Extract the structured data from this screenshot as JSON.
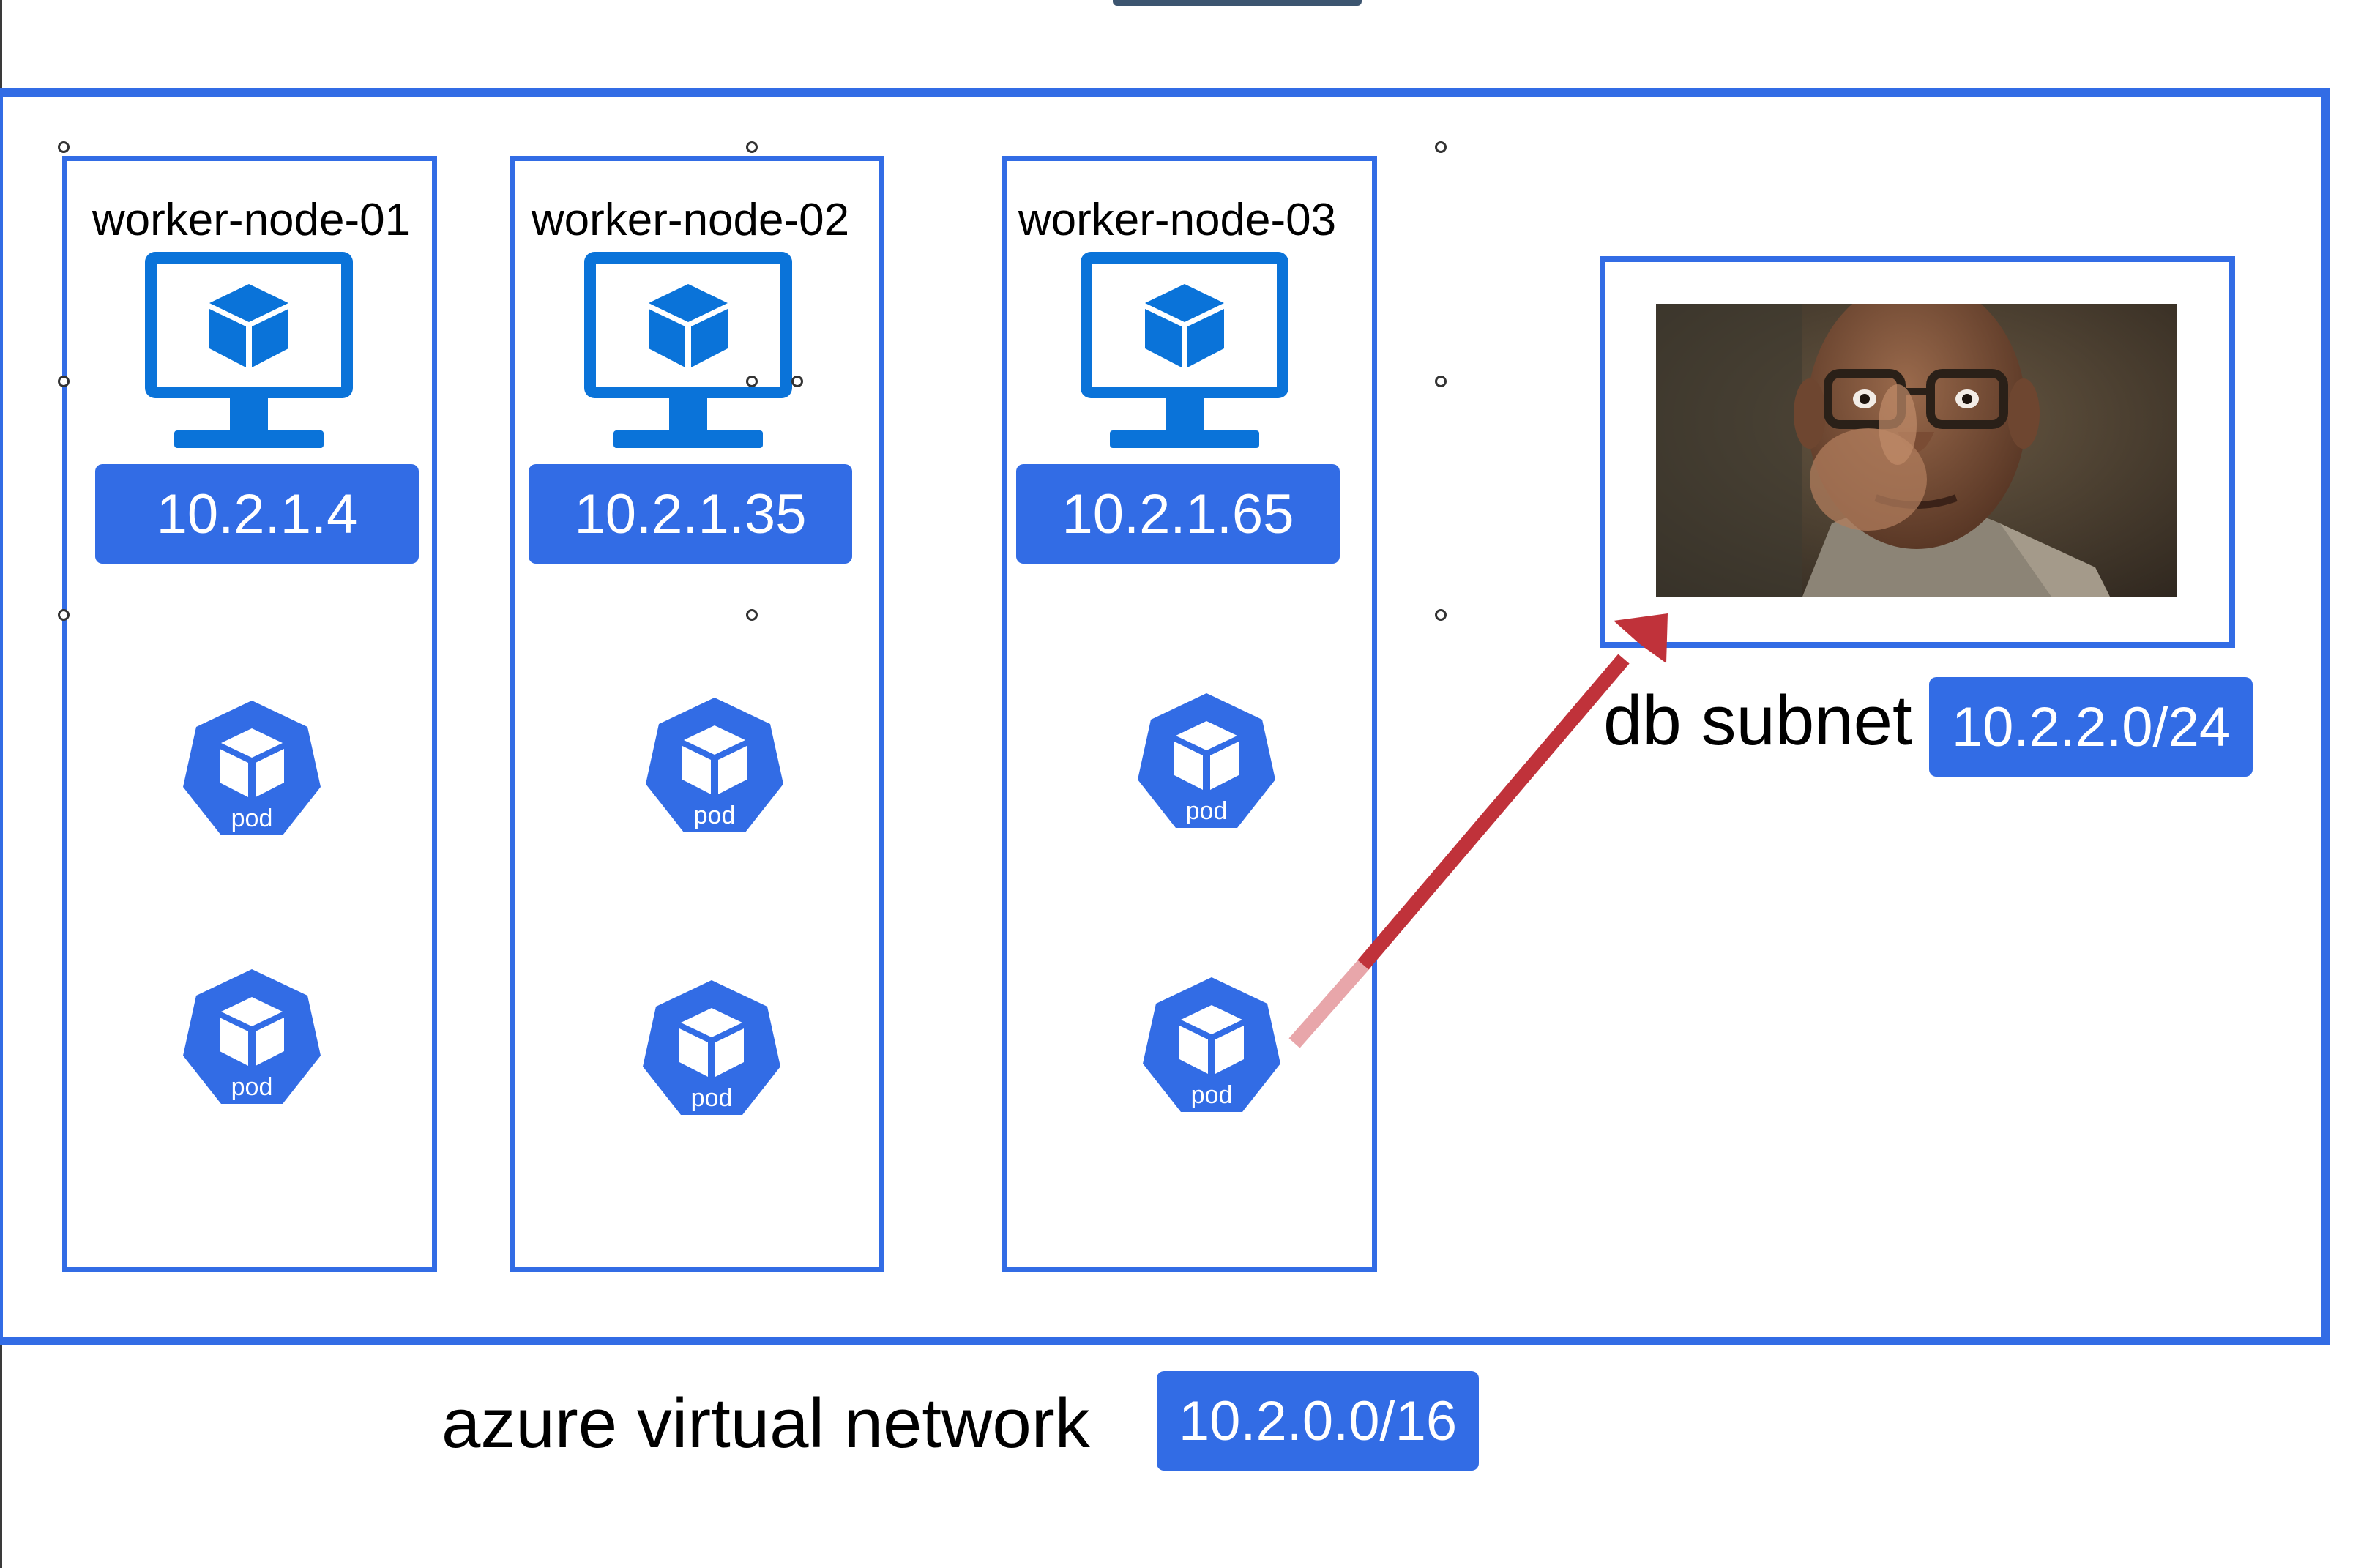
{
  "vnet": {
    "label": "azure virtual network",
    "cidr": "10.2.0.0/16"
  },
  "nodes": [
    {
      "title": "worker-node-01",
      "ip": "10.2.1.4",
      "pods": [
        "pod",
        "pod"
      ]
    },
    {
      "title": "worker-node-02",
      "ip": "10.2.1.35",
      "pods": [
        "pod",
        "pod"
      ]
    },
    {
      "title": "worker-node-03",
      "ip": "10.2.1.65",
      "pods": [
        "pod",
        "pod"
      ]
    }
  ],
  "db": {
    "label": "db subnet",
    "cidr": "10.2.2.0/24"
  },
  "colors": {
    "accent": "#326ce5",
    "arrow": "#c0323a",
    "arrow_tail": "#e8a6aa"
  },
  "icons": {
    "node": "vm-monitor-icon",
    "pod": "kubernetes-pod-icon"
  }
}
